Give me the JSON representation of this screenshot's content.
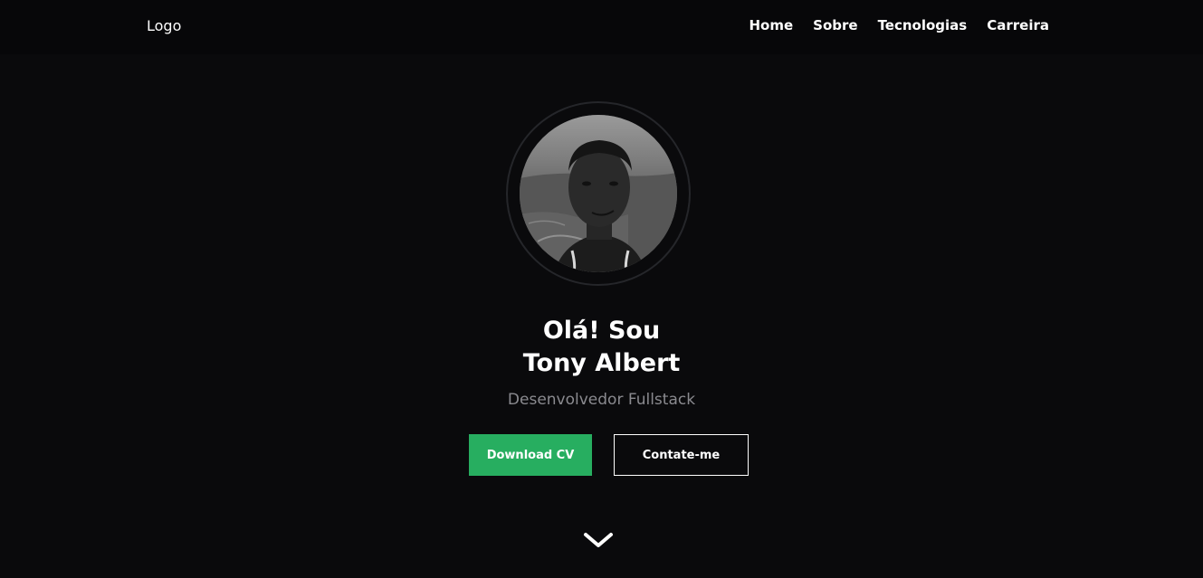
{
  "header": {
    "logo": "Logo",
    "nav": [
      {
        "label": "Home"
      },
      {
        "label": "Sobre"
      },
      {
        "label": "Tecnologias"
      },
      {
        "label": "Carreira"
      }
    ]
  },
  "hero": {
    "greeting": "Olá! Sou",
    "name": "Tony Albert",
    "role": "Desenvolvedor Fullstack",
    "download_label": "Download CV",
    "contact_label": "Contate-me",
    "scroll_icon": "chevron-down-icon"
  },
  "colors": {
    "background": "#0a0a0c",
    "accent": "#27ae60",
    "muted_text": "#8a8a8f"
  }
}
